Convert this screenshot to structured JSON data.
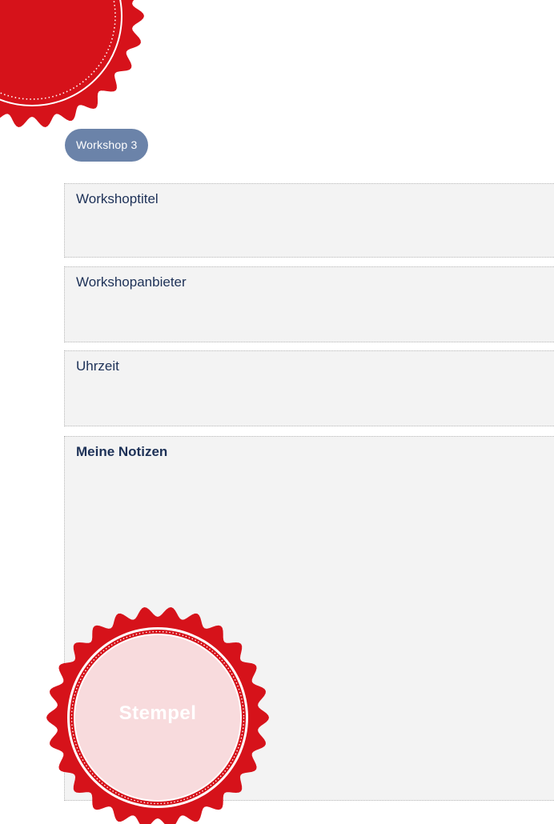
{
  "workshop": {
    "badge_label": "Workshop 3"
  },
  "fields": {
    "title_label": "Workshoptitel",
    "provider_label": "Workshopanbieter",
    "time_label": "Uhrzeit",
    "notes_label": "Meine Notizen"
  },
  "stamp": {
    "label": "Stempel"
  },
  "colors": {
    "seal_red": "#d6121a",
    "stamp_fill": "#f8dbdd",
    "badge_bg": "#6b83a9",
    "label_text": "#1d3157",
    "field_bg": "#f3f3f3"
  }
}
